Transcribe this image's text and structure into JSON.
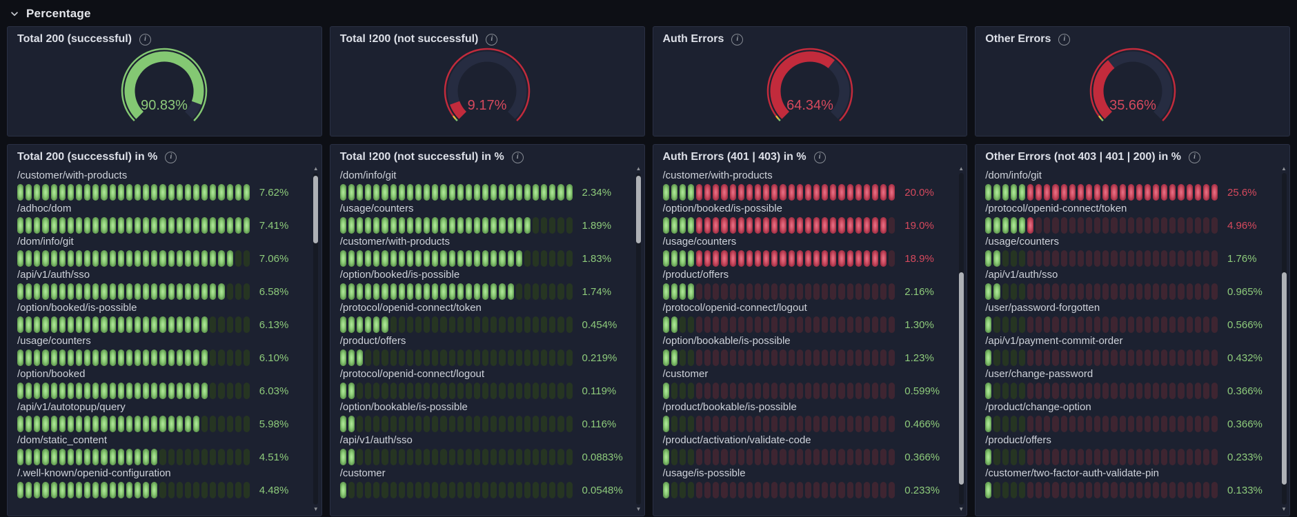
{
  "section": {
    "title": "Percentage"
  },
  "colors": {
    "green_arc": "#84c873",
    "green_text": "#8ecb7b",
    "red_arc": "#c22b3c",
    "red_text": "#d6495d",
    "yellow": "#e8b93b",
    "gauge_track": "#262c41",
    "lit_green_cell": "#8ccc77",
    "unlit_green_cell": "#263522",
    "lit_red_cell": "#cf5064",
    "unlit_red_cell": "#3e2531"
  },
  "gauges": [
    {
      "title": "Total 200 (successful)",
      "value": 90.83,
      "display": "90.83%",
      "color": "green",
      "ring": [
        {
          "color": "#84c873",
          "to": 100
        }
      ]
    },
    {
      "title": "Total !200 (not successful)",
      "value": 9.17,
      "display": "9.17%",
      "color": "red",
      "ring": [
        {
          "color": "#84c873",
          "to": 1.2
        },
        {
          "color": "#e8b93b",
          "to": 3.2
        },
        {
          "color": "#c22b3c",
          "to": 100
        }
      ]
    },
    {
      "title": "Auth Errors",
      "value": 64.34,
      "display": "64.34%",
      "color": "red",
      "ring": [
        {
          "color": "#84c873",
          "to": 1.2
        },
        {
          "color": "#e8b93b",
          "to": 3.2
        },
        {
          "color": "#c22b3c",
          "to": 100
        }
      ]
    },
    {
      "title": "Other Errors",
      "value": 35.66,
      "display": "35.66%",
      "color": "red",
      "ring": [
        {
          "color": "#84c873",
          "to": 1.2
        },
        {
          "color": "#e8b93b",
          "to": 3.2
        },
        {
          "color": "#c22b3c",
          "to": 100
        }
      ]
    }
  ],
  "bar_panels": [
    {
      "title": "Total 200 (successful) in %",
      "green_cells": 28,
      "rows": [
        {
          "label": "/customer/with-products",
          "value": 7.62,
          "display": "7.62%"
        },
        {
          "label": "/adhoc/dom",
          "value": 7.41,
          "display": "7.41%"
        },
        {
          "label": "/dom/info/git",
          "value": 7.06,
          "display": "7.06%"
        },
        {
          "label": "/api/v1/auth/sso",
          "value": 6.58,
          "display": "6.58%"
        },
        {
          "label": "/option/booked/is-possible",
          "value": 6.13,
          "display": "6.13%"
        },
        {
          "label": "/usage/counters",
          "value": 6.1,
          "display": "6.10%"
        },
        {
          "label": "/option/booked",
          "value": 6.03,
          "display": "6.03%"
        },
        {
          "label": "/api/v1/autotopup/query",
          "value": 5.98,
          "display": "5.98%"
        },
        {
          "label": "/dom/static_content",
          "value": 4.51,
          "display": "4.51%"
        },
        {
          "label": "/.well-known/openid-configuration",
          "value": 4.48,
          "display": "4.48%"
        }
      ]
    },
    {
      "title": "Total !200 (not successful) in %",
      "green_cells": 28,
      "rows": [
        {
          "label": "/dom/info/git",
          "value": 2.34,
          "display": "2.34%"
        },
        {
          "label": "/usage/counters",
          "value": 1.89,
          "display": "1.89%"
        },
        {
          "label": "/customer/with-products",
          "value": 1.83,
          "display": "1.83%"
        },
        {
          "label": "/option/booked/is-possible",
          "value": 1.74,
          "display": "1.74%"
        },
        {
          "label": "/protocol/openid-connect/token",
          "value": 0.454,
          "display": "0.454%"
        },
        {
          "label": "/product/offers",
          "value": 0.219,
          "display": "0.219%"
        },
        {
          "label": "/protocol/openid-connect/logout",
          "value": 0.119,
          "display": "0.119%"
        },
        {
          "label": "/option/bookable/is-possible",
          "value": 0.116,
          "display": "0.116%"
        },
        {
          "label": "/api/v1/auth/sso",
          "value": 0.0883,
          "display": "0.0883%"
        },
        {
          "label": "/customer",
          "value": 0.0548,
          "display": "0.0548%"
        }
      ]
    },
    {
      "title": "Auth Errors (401 | 403) in %",
      "green_cells": 4,
      "rows": [
        {
          "label": "/customer/with-products",
          "value": 20.0,
          "display": "20.0%"
        },
        {
          "label": "/option/booked/is-possible",
          "value": 19.0,
          "display": "19.0%"
        },
        {
          "label": "/usage/counters",
          "value": 18.9,
          "display": "18.9%"
        },
        {
          "label": "/product/offers",
          "value": 2.16,
          "display": "2.16%"
        },
        {
          "label": "/protocol/openid-connect/logout",
          "value": 1.3,
          "display": "1.30%"
        },
        {
          "label": "/option/bookable/is-possible",
          "value": 1.23,
          "display": "1.23%"
        },
        {
          "label": "/customer",
          "value": 0.599,
          "display": "0.599%"
        },
        {
          "label": "/product/bookable/is-possible",
          "value": 0.466,
          "display": "0.466%"
        },
        {
          "label": "/product/activation/validate-code",
          "value": 0.366,
          "display": "0.366%"
        },
        {
          "label": "/usage/is-possible",
          "value": 0.233,
          "display": "0.233%"
        }
      ]
    },
    {
      "title": "Other Errors (not 403 | 401 | 200) in %",
      "green_cells": 5,
      "rows": [
        {
          "label": "/dom/info/git",
          "value": 25.6,
          "display": "25.6%"
        },
        {
          "label": "/protocol/openid-connect/token",
          "value": 4.96,
          "display": "4.96%"
        },
        {
          "label": "/usage/counters",
          "value": 1.76,
          "display": "1.76%"
        },
        {
          "label": "/api/v1/auth/sso",
          "value": 0.965,
          "display": "0.965%"
        },
        {
          "label": "/user/password-forgotten",
          "value": 0.566,
          "display": "0.566%"
        },
        {
          "label": "/api/v1/payment-commit-order",
          "value": 0.432,
          "display": "0.432%"
        },
        {
          "label": "/user/change-password",
          "value": 0.366,
          "display": "0.366%"
        },
        {
          "label": "/product/change-option",
          "value": 0.366,
          "display": "0.366%"
        },
        {
          "label": "/product/offers",
          "value": 0.233,
          "display": "0.233%"
        },
        {
          "label": "/customer/two-factor-auth-validate-pin",
          "value": 0.133,
          "display": "0.133%"
        }
      ]
    }
  ]
}
